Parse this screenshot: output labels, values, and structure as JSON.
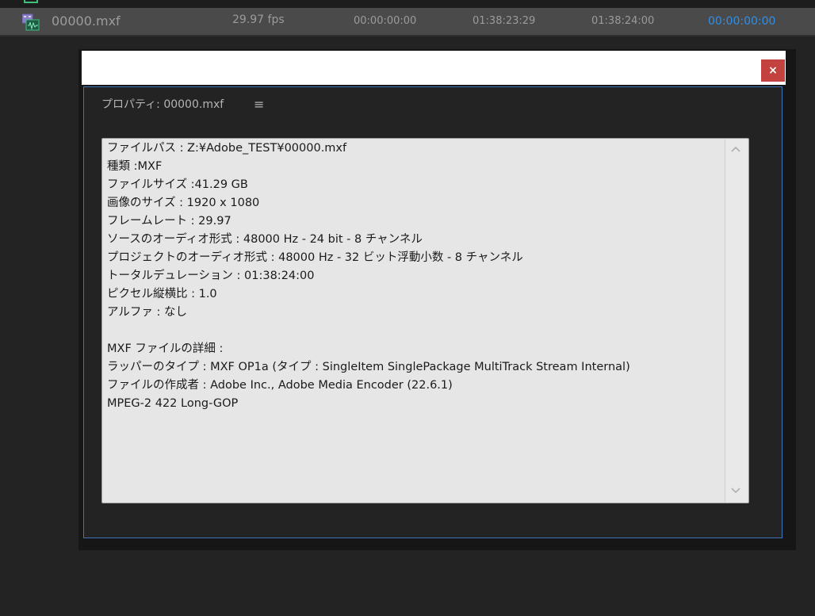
{
  "clip": {
    "name": "00000.mxf",
    "frame_rate": "29.97 fps",
    "media_start": "00:00:00:00",
    "media_end": "01:38:23:29",
    "media_duration": "01:38:24:00",
    "video_in": "00:00:00:00"
  },
  "dialog": {
    "close_label": "×",
    "panel_title": "プロパティ:  00000.mxf",
    "menu_label": "≡",
    "scroll_up_label": "⌃",
    "scroll_down_label": "⌄",
    "lines": [
      "ファイルパス : Z:¥Adobe_TEST¥00000.mxf",
      "種類 :MXF",
      "ファイルサイズ :41.29 GB",
      "画像のサイズ : 1920 x 1080",
      "フレームレート : 29.97",
      "ソースのオーディオ形式 : 48000 Hz - 24 bit - 8 チャンネル",
      "プロジェクトのオーディオ形式 : 48000 Hz - 32 ビット浮動小数 - 8 チャンネル",
      "トータルデュレーション : 01:38:24:00",
      "ピクセル縦横比 : 1.0",
      "アルファ : なし",
      "",
      "MXF ファイルの詳細 :",
      "ラッパーのタイプ : MXF OP1a (タイプ : SingleItem SinglePackage MultiTrack Stream Internal)",
      "ファイルの作成者 : Adobe Inc., Adobe Media Encoder (22.6.1)",
      "MPEG-2 422 Long-GOP"
    ]
  },
  "colors": {
    "background": "#232323",
    "clip_row": "#4a4a4a",
    "accent_timecode": "#2f8fe8",
    "close_button": "#c3423f",
    "panel_border": "#3f74b8",
    "text_area": "#e6e6e6"
  },
  "icons": {
    "clip": "film-audio-clip-icon",
    "close": "close-icon",
    "menu": "hamburger-menu-icon",
    "scroll_up": "chevron-up-icon",
    "scroll_down": "chevron-down-icon"
  }
}
